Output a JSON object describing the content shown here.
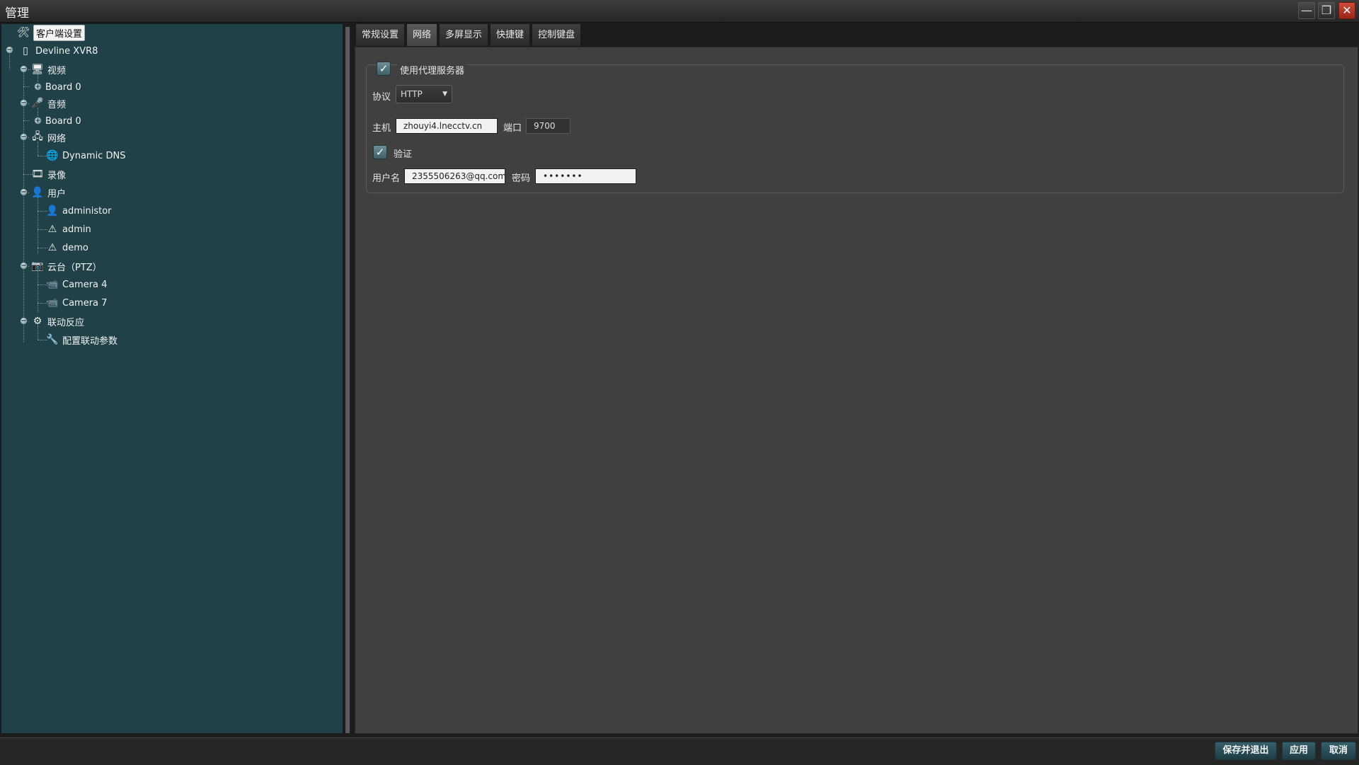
{
  "window": {
    "title": "管理"
  },
  "tree": {
    "client_settings": "客户端设置",
    "device": "Devline XVR8",
    "video": "视频",
    "video_board": "Board 0",
    "audio": "音频",
    "audio_board": "Board 0",
    "network": "网络",
    "dynamic_dns": "Dynamic DNS",
    "recording": "录像",
    "users": "用户",
    "user_items": [
      "administor",
      "admin",
      "demo"
    ],
    "ptz": "云台（PTZ）",
    "cameras": [
      "Camera 4",
      "Camera 7"
    ],
    "linkage": "联动反应",
    "linkage_config": "配置联动参数"
  },
  "tabs": [
    "常规设置",
    "网络",
    "多屏显示",
    "快捷键",
    "控制键盘"
  ],
  "active_tab": "网络",
  "proxy": {
    "use_proxy_label": "使用代理服务器",
    "use_proxy_checked": true,
    "protocol_label": "协议",
    "protocol_value": "HTTP",
    "host_label": "主机",
    "host_value": "zhouyi4.lnecctv.cn",
    "port_label": "端口",
    "port_value": "9700",
    "auth_label": "验证",
    "auth_checked": true,
    "username_label": "用户名",
    "username_value": "2355506263@qq.com",
    "password_label": "密码",
    "password_value": "•••••••"
  },
  "footer": {
    "save_exit": "保存并退出",
    "apply": "应用",
    "cancel": "取消"
  },
  "icons": {
    "minimize": "minimize-icon",
    "maximize": "maximize-icon",
    "close": "close-icon"
  }
}
